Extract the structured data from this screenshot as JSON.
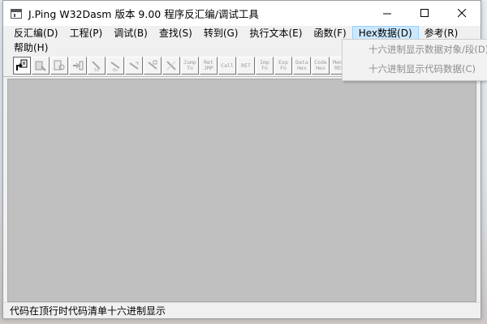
{
  "window": {
    "title": "J.Ping W32Dasm 版本 9.00 程序反汇编/调试工具"
  },
  "menu": {
    "items": [
      {
        "label": "反汇编(D)"
      },
      {
        "label": "工程(P)"
      },
      {
        "label": "调试(B)"
      },
      {
        "label": "查找(S)"
      },
      {
        "label": "转到(G)"
      },
      {
        "label": "执行文本(E)"
      },
      {
        "label": "函数(F)"
      },
      {
        "label": "Hex数据(D)"
      },
      {
        "label": "参考(R)"
      }
    ],
    "help_label": "帮助(H)"
  },
  "toolbar": {
    "buttons": [
      {
        "icon": "open-file-icon",
        "text": ""
      },
      {
        "icon": "save-icon",
        "text": ""
      },
      {
        "icon": "find-icon",
        "text": ""
      },
      {
        "icon": "load-icon",
        "text": ""
      },
      {
        "icon": "step-into-icon",
        "text": ""
      },
      {
        "icon": "step-over-icon",
        "text": ""
      },
      {
        "icon": "run-icon",
        "text": ""
      },
      {
        "icon": "pause-icon",
        "text": ""
      },
      {
        "icon": "terminate-icon",
        "text": ""
      },
      {
        "icon": "jump-to-icon",
        "text": "Jump To"
      },
      {
        "icon": "return-icon",
        "text": "Ret JMP"
      },
      {
        "icon": "call-icon",
        "text": "Call"
      },
      {
        "icon": "ret-icon",
        "text": "RET"
      },
      {
        "icon": "imports-icon",
        "text": "Imp Fn"
      },
      {
        "icon": "exports-icon",
        "text": "Exp Fn"
      },
      {
        "icon": "data-hex-icon",
        "text": "Data Hex"
      },
      {
        "icon": "code-hex-icon",
        "text": "Code Hex"
      },
      {
        "icon": "menu-ref-icon",
        "text": "Menu REF"
      }
    ]
  },
  "hex_menu": {
    "items": [
      {
        "label": "十六进制显示数据对象/段(D)"
      },
      {
        "label": "十六进制显示代码数据(C)"
      }
    ]
  },
  "status": {
    "text": "代码在顶行时代码清单十六进制显示"
  },
  "colors": {
    "client_background": "#c0c0c0",
    "menu_active_background": "#cce8ff",
    "disabled_text": "#8d8d8d"
  }
}
